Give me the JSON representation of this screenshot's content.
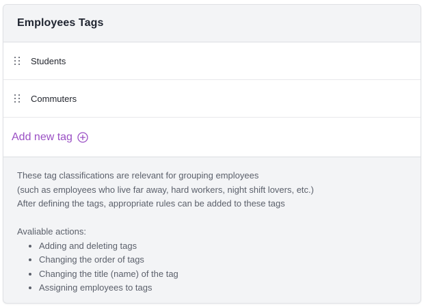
{
  "card": {
    "title": "Employees Tags"
  },
  "tags": [
    {
      "label": "Students"
    },
    {
      "label": "Commuters"
    }
  ],
  "add_tag": {
    "label": "Add new tag",
    "icon": "plus-circle-icon"
  },
  "info": {
    "lines": [
      "These tag classifications are relevant for grouping employees",
      "(such as employees who live far away, hard workers, night shift lovers, etc.)",
      "After defining the tags, appropriate rules can be added to these tags"
    ],
    "actions_title": "Avaliable actions:",
    "actions": [
      "Adding and deleting tags",
      "Changing the order of tags",
      "Changing the title (name) of the tag",
      "Assigning employees to tags"
    ]
  },
  "colors": {
    "accent": "#9a4fc4",
    "panel_bg": "#f3f4f6",
    "text_dark": "#1f2430",
    "text_muted": "#5b606b"
  }
}
